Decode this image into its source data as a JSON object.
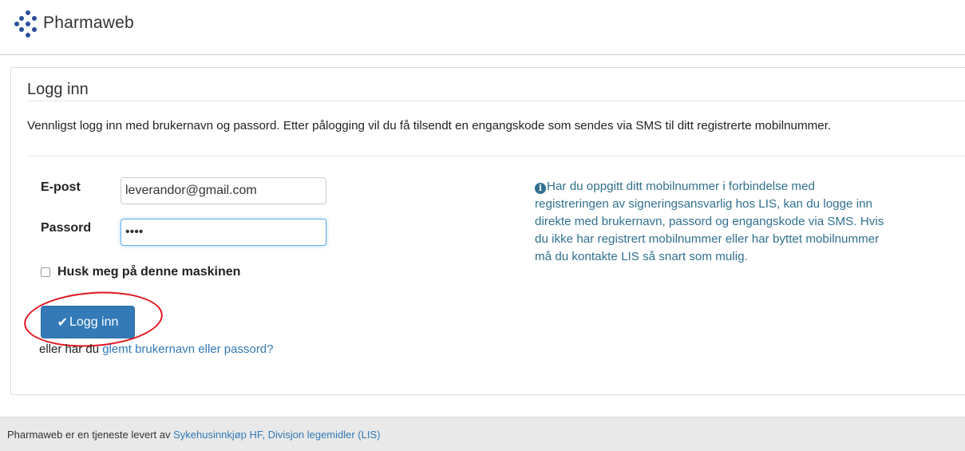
{
  "header": {
    "app_name": "Pharmaweb"
  },
  "panel": {
    "title": "Logg inn",
    "intro": "Vennligst logg inn med brukernavn og passord. Etter pålogging vil du få tilsendt en engangskode som sendes via SMS til ditt registrerte mobilnummer."
  },
  "form": {
    "email_label": "E-post",
    "email_value": "leverandor@gmail.com",
    "password_label": "Passord",
    "password_value": "••••",
    "remember_label": "Husk meg på denne maskinen",
    "login_button_label": "Logg inn",
    "forgot_prefix": "eller har du ",
    "forgot_link": "glemt brukernavn eller passord?"
  },
  "info": {
    "icon": "info-circle-icon",
    "text": "Har du oppgitt ditt mobilnummer i forbindelse med registreringen av signeringsansvarlig hos LIS, kan du logge inn direkte med brukernavn, passord og engangskode via SMS. Hvis du ikke har registrert mobilnummer eller har byttet mobilnummer må du kontakte LIS så snart som mulig."
  },
  "footer": {
    "text": "Pharmaweb er en tjeneste levert av ",
    "link": "Sykehusinnkjøp HF, Divisjon legemidler (LIS)"
  },
  "colors": {
    "primary": "#337ab7",
    "info_text": "#31708f",
    "highlight_circle": "#e0161f",
    "logo_dots": "#2a4f9a"
  }
}
